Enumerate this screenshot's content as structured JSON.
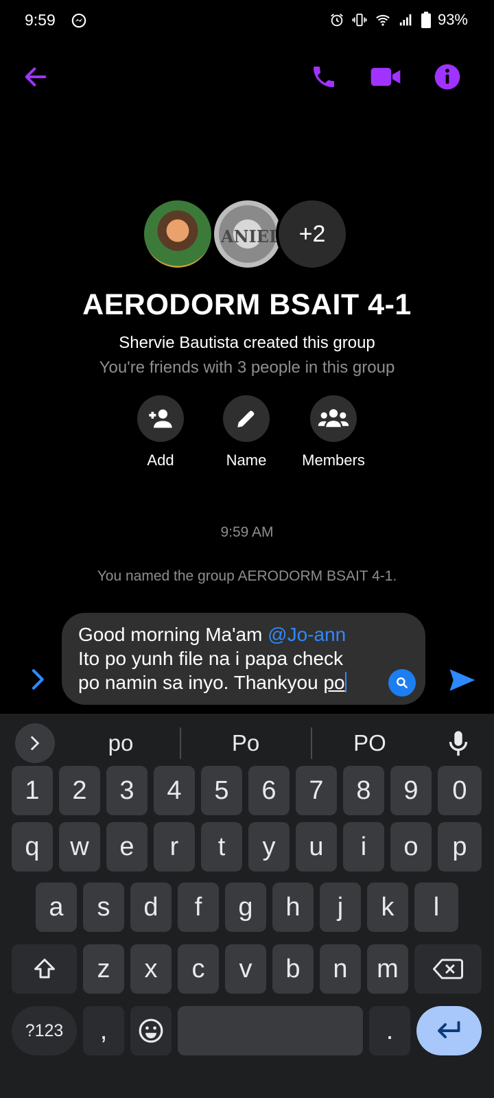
{
  "status_bar": {
    "time": "9:59",
    "battery": "93%"
  },
  "header": {
    "accent_color": "#a033ff"
  },
  "group": {
    "avatar_more": "+2",
    "avatar_2_text": "ANIEL'S",
    "title": "AERODORM BSAIT 4-1",
    "created_by": "Shervie Bautista created this group",
    "friends_line": "You're friends with 3 people in this group",
    "actions": {
      "add": "Add",
      "name": "Name",
      "members": "Members"
    }
  },
  "conversation": {
    "timestamp": "9:59 AM",
    "system_message": "You named the group AERODORM BSAIT 4-1."
  },
  "composer": {
    "line1_prefix": "Good morning Ma'am ",
    "mention": "@Jo-ann",
    "line2": "Ito po yunh file na i papa check",
    "line3_prefix": "po namin sa inyo. Thankyou ",
    "typed_word": "po"
  },
  "keyboard": {
    "suggestions": [
      "po",
      "Po",
      "PO"
    ],
    "number_row": [
      "1",
      "2",
      "3",
      "4",
      "5",
      "6",
      "7",
      "8",
      "9",
      "0"
    ],
    "row1": [
      "q",
      "w",
      "e",
      "r",
      "t",
      "y",
      "u",
      "i",
      "o",
      "p"
    ],
    "row2": [
      "a",
      "s",
      "d",
      "f",
      "g",
      "h",
      "j",
      "k",
      "l"
    ],
    "row3": [
      "z",
      "x",
      "c",
      "v",
      "b",
      "n",
      "m"
    ],
    "symbols_label": "?123",
    "comma_label": ",",
    "period_label": "."
  }
}
